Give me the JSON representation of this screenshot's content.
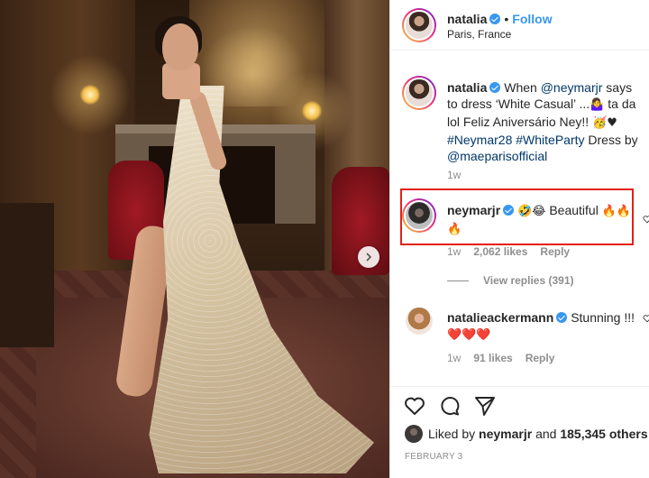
{
  "post": {
    "author": "natalia",
    "follow_label": "Follow",
    "location": "Paris, France"
  },
  "caption": {
    "username": "natalia",
    "text_1": "When ",
    "mention_1": "@neymarjr",
    "text_2": " says to dress ‘White Casual’ ...",
    "emoji_1": "🤷‍♀️",
    "text_3": " ta da lol Feliz Aniversário Ney!! ",
    "emoji_2": "🥳♥",
    "hashtag_1": "#Neymar28",
    "hashtag_2": "#WhiteParty",
    "text_4": " Dress by ",
    "mention_2": "@maeparisofficial",
    "time": "1w"
  },
  "comments": [
    {
      "username": "neymarjr",
      "emojis_a": "🤣😂",
      "text": " Beautiful ",
      "emojis_b": "🔥🔥",
      "emojis_c": "🔥",
      "time": "1w",
      "likes": "2,062 likes",
      "reply_label": "Reply",
      "view_replies": "View replies (391)"
    },
    {
      "username": "natalieackermann",
      "text": "Stunning !!!",
      "emojis": "❤️❤️❤️",
      "time": "1w",
      "likes": "91 likes",
      "reply_label": "Reply"
    }
  ],
  "footer": {
    "liked_by_prefix": "Liked by ",
    "liked_by_user": "neymarjr",
    "liked_by_middle": " and ",
    "liked_by_count": "185,345 others",
    "date": "FEBRUARY 3"
  },
  "colors": {
    "link": "#00376b",
    "follow": "#3897f0",
    "verified": "#3897f0",
    "highlight_box": "#e32018",
    "muted": "#8e8e8e"
  },
  "icons": [
    "chevron-right-icon",
    "verified-badge-icon",
    "heart-icon",
    "comment-icon",
    "share-icon",
    "small-heart-icon"
  ]
}
